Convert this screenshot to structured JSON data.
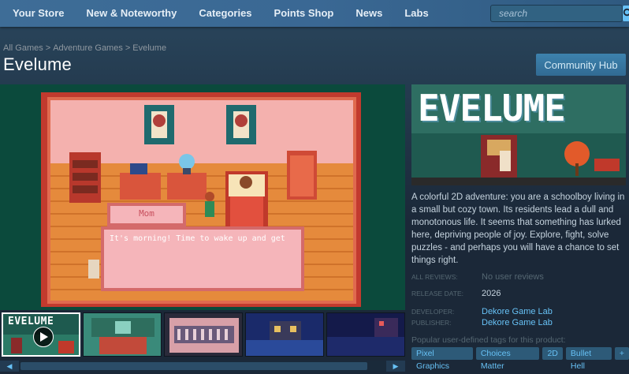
{
  "nav": {
    "items": [
      "Your Store",
      "New & Noteworthy",
      "Categories",
      "Points Shop",
      "News",
      "Labs"
    ],
    "search_placeholder": "search"
  },
  "breadcrumb": [
    "All Games",
    "Adventure Games",
    "Evelume"
  ],
  "game": {
    "title": "Evelume",
    "capsule_logo": "EVELUME",
    "description": "A colorful 2D adventure: you are a schoolboy living in a small but cozy town. Its residents lead a dull and monotonous life. It seems that something has lurked here, depriving people of joy. Explore, fight, solve puzzles - and perhaps you will have a chance to set things right."
  },
  "community_hub_label": "Community Hub",
  "screenshot": {
    "speaker": "Mom",
    "dialog": "It's morning! Time to wake up and get"
  },
  "thumbnails": {
    "first_logo": "EVELUME"
  },
  "meta": {
    "reviews_label": "ALL REVIEWS:",
    "reviews_value": "No user reviews",
    "release_label": "RELEASE DATE:",
    "release_value": "2026",
    "developer_label": "DEVELOPER:",
    "developer_value": "Dekore Game Lab",
    "publisher_label": "PUBLISHER:",
    "publisher_value": "Dekore Game Lab"
  },
  "tags_label": "Popular user-defined tags for this product:",
  "tags": [
    "Pixel Graphics",
    "Choices Matter",
    "2D",
    "Bullet Hell",
    "+"
  ],
  "colors": {
    "nav_bg": "#3a6894",
    "page_bg": "#1b2838",
    "link": "#67c1f5",
    "muted": "#556772"
  }
}
